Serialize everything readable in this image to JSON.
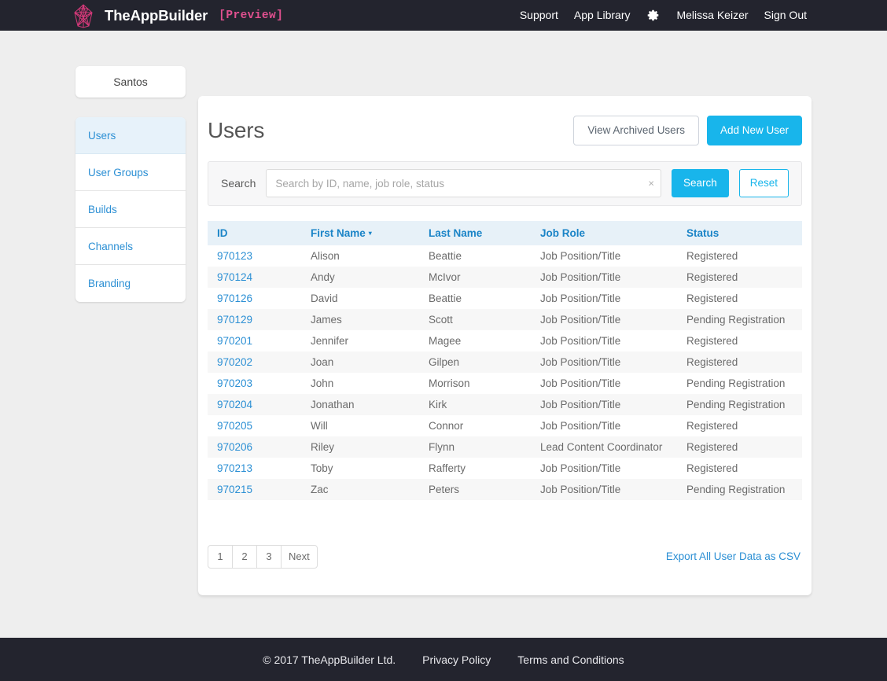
{
  "topnav": {
    "brand_name": "TheAppBuilder",
    "brand_tag": "[Preview]",
    "logo_icon": "polyhedron-logo-icon",
    "links": [
      {
        "label": "Support",
        "name": "support"
      },
      {
        "label": "App Library",
        "name": "app-library"
      }
    ],
    "settings_icon": "gear-icon",
    "user_name": "Melissa Keizer",
    "sign_out": "Sign Out",
    "bg_color": "#23242e",
    "brand_tag_color": "#e0508f"
  },
  "sidebar": {
    "org_name": "Santos",
    "items": [
      {
        "label": "Users",
        "name": "users",
        "active": true
      },
      {
        "label": "User Groups",
        "name": "user-groups",
        "active": false
      },
      {
        "label": "Builds",
        "name": "builds",
        "active": false
      },
      {
        "label": "Channels",
        "name": "channels",
        "active": false
      },
      {
        "label": "Branding",
        "name": "branding",
        "active": false
      }
    ],
    "link_color": "#2b8fd4",
    "active_bg": "#e7f2fa"
  },
  "main": {
    "title": "Users",
    "view_archived_label": "View Archived Users",
    "add_user_label": "Add New User",
    "accent_color": "#18b5eb"
  },
  "search": {
    "label": "Search",
    "value": "",
    "placeholder": "Search by ID, name, job role, status",
    "clear_icon": "×",
    "search_button": "Search",
    "reset_button": "Reset"
  },
  "table": {
    "columns": [
      {
        "label": "ID",
        "name": "id",
        "sorted": false
      },
      {
        "label": "First Name",
        "name": "first-name",
        "sorted": true,
        "sort_caret": "▾"
      },
      {
        "label": "Last Name",
        "name": "last-name",
        "sorted": false
      },
      {
        "label": "Job Role",
        "name": "job-role",
        "sorted": false
      },
      {
        "label": "Status",
        "name": "status",
        "sorted": false
      }
    ],
    "rows": [
      {
        "id": "970123",
        "first": "Alison",
        "last": "Beattie",
        "job": "Job Position/Title",
        "status": "Registered"
      },
      {
        "id": "970124",
        "first": "Andy",
        "last": "McIvor",
        "job": "Job Position/Title",
        "status": "Registered"
      },
      {
        "id": "970126",
        "first": "David",
        "last": "Beattie",
        "job": "Job Position/Title",
        "status": "Registered"
      },
      {
        "id": "970129",
        "first": "James",
        "last": "Scott",
        "job": "Job Position/Title",
        "status": "Pending Registration"
      },
      {
        "id": "970201",
        "first": "Jennifer",
        "last": "Magee",
        "job": "Job Position/Title",
        "status": "Registered"
      },
      {
        "id": "970202",
        "first": "Joan",
        "last": "Gilpen",
        "job": "Job Position/Title",
        "status": "Registered"
      },
      {
        "id": "970203",
        "first": "John",
        "last": "Morrison",
        "job": "Job Position/Title",
        "status": "Pending Registration"
      },
      {
        "id": "970204",
        "first": "Jonathan",
        "last": "Kirk",
        "job": "Job Position/Title",
        "status": "Pending Registration"
      },
      {
        "id": "970205",
        "first": "Will",
        "last": "Connor",
        "job": "Job Position/Title",
        "status": "Registered"
      },
      {
        "id": "970206",
        "first": "Riley",
        "last": "Flynn",
        "job": "Lead Content Coordinator",
        "status": "Registered"
      },
      {
        "id": "970213",
        "first": "Toby",
        "last": "Rafferty",
        "job": "Job Position/Title",
        "status": "Registered"
      },
      {
        "id": "970215",
        "first": "Zac",
        "last": "Peters",
        "job": "Job Position/Title",
        "status": "Pending Registration"
      }
    ]
  },
  "pagination": {
    "pages": [
      "1",
      "2",
      "3"
    ],
    "next_label": "Next",
    "current": "1"
  },
  "export": {
    "label": "Export All User Data as CSV"
  },
  "footer": {
    "copyright": "© 2017 TheAppBuilder Ltd.",
    "links": [
      {
        "label": "Privacy Policy",
        "name": "privacy-policy"
      },
      {
        "label": "Terms and Conditions",
        "name": "terms-and-conditions"
      }
    ]
  }
}
